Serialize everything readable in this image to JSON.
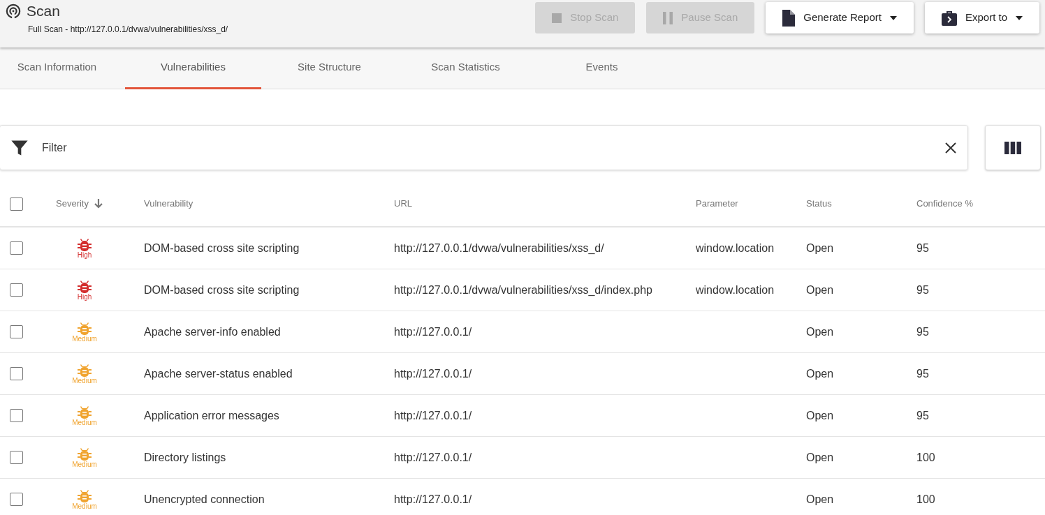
{
  "header": {
    "title": "Scan",
    "subtitle": "Full Scan - http://127.0.0.1/dvwa/vulnerabilities/xss_d/"
  },
  "actions": [
    {
      "kind": "stop",
      "label": "Stop Scan",
      "disabled": true,
      "dropdown": false
    },
    {
      "kind": "pause",
      "label": "Pause Scan",
      "disabled": true,
      "dropdown": false
    },
    {
      "kind": "report",
      "label": "Generate Report",
      "disabled": false,
      "dropdown": true
    },
    {
      "kind": "export",
      "label": "Export to",
      "disabled": false,
      "dropdown": true
    }
  ],
  "tabs": [
    {
      "label": "Scan Information",
      "selected": false
    },
    {
      "label": "Vulnerabilities",
      "selected": true
    },
    {
      "label": "Site Structure",
      "selected": false
    },
    {
      "label": "Scan Statistics",
      "selected": false
    },
    {
      "label": "Events",
      "selected": false
    }
  ],
  "filter": {
    "placeholder": "Filter"
  },
  "table": {
    "select_all": {
      "checked": false
    },
    "columns": [
      "Severity",
      "Vulnerability",
      "URL",
      "Parameter",
      "Status",
      "Confidence %"
    ],
    "rows": [
      {
        "checked": false,
        "severity": "High",
        "color": "#d32f2f",
        "vulnerability": "DOM-based cross site scripting",
        "url": "http://127.0.0.1/dvwa/vulnerabilities/xss_d/",
        "parameter": "window.location",
        "status": "Open",
        "confidence": "95"
      },
      {
        "checked": false,
        "severity": "High",
        "color": "#d32f2f",
        "vulnerability": "DOM-based cross site scripting",
        "url": "http://127.0.0.1/dvwa/vulnerabilities/xss_d/index.php",
        "parameter": "window.location",
        "status": "Open",
        "confidence": "95"
      },
      {
        "checked": false,
        "severity": "Medium",
        "color": "#f0a430",
        "vulnerability": "Apache server-info enabled",
        "url": "http://127.0.0.1/",
        "parameter": "",
        "status": "Open",
        "confidence": "95"
      },
      {
        "checked": false,
        "severity": "Medium",
        "color": "#f0a430",
        "vulnerability": "Apache server-status enabled",
        "url": "http://127.0.0.1/",
        "parameter": "",
        "status": "Open",
        "confidence": "95"
      },
      {
        "checked": false,
        "severity": "Medium",
        "color": "#f0a430",
        "vulnerability": "Application error messages",
        "url": "http://127.0.0.1/",
        "parameter": "",
        "status": "Open",
        "confidence": "95"
      },
      {
        "checked": false,
        "severity": "Medium",
        "color": "#f0a430",
        "vulnerability": "Directory listings",
        "url": "http://127.0.0.1/",
        "parameter": "",
        "status": "Open",
        "confidence": "100"
      },
      {
        "checked": false,
        "severity": "Medium",
        "color": "#f0a430",
        "vulnerability": "Unencrypted connection",
        "url": "http://127.0.0.1/",
        "parameter": "",
        "status": "Open",
        "confidence": "100"
      }
    ]
  }
}
